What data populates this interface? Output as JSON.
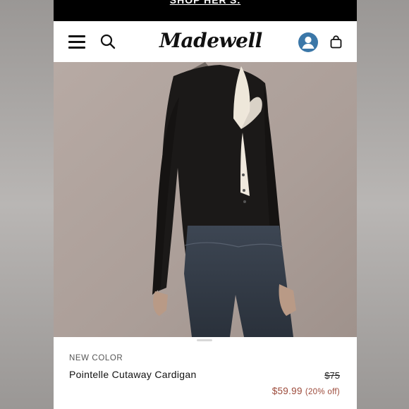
{
  "promo_bar": {
    "text": "SHOP HER'S."
  },
  "header": {
    "logo_text": "Madewell",
    "icons": [
      "menu-icon",
      "search-icon",
      "account-icon",
      "shopping-bag-icon"
    ],
    "account_color": "#3b77a8"
  },
  "product": {
    "badge": "NEW COLOR",
    "name": "Pointelle Cutaway Cardigan",
    "original_price": "$75",
    "sale_price": "$59.99",
    "discount": "(20% off)",
    "sale_color": "#9c4a3a"
  }
}
